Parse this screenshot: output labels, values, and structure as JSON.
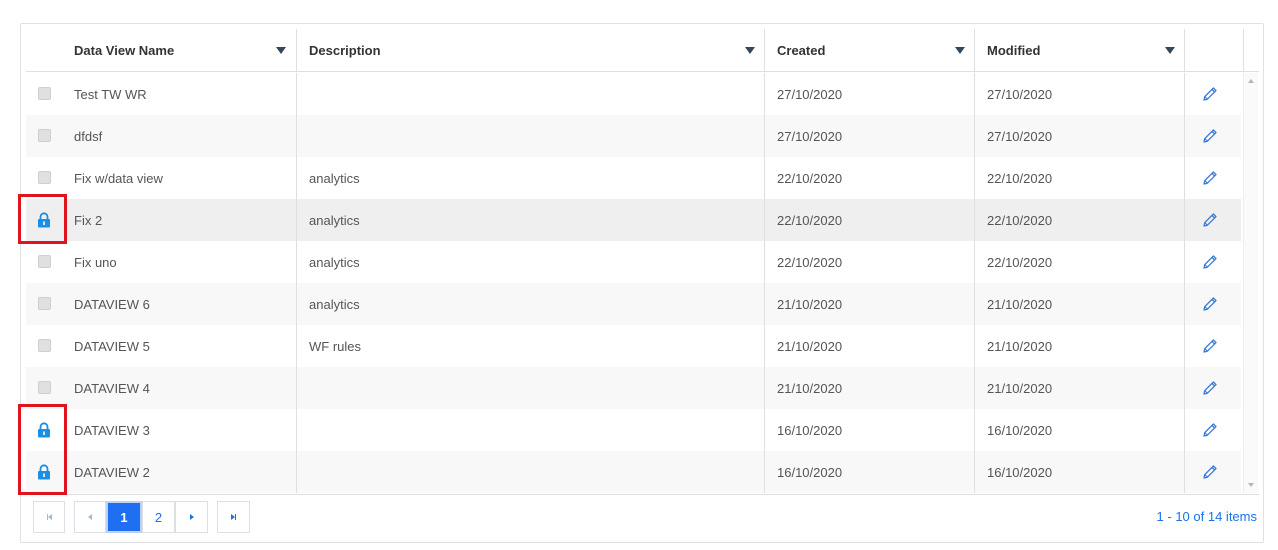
{
  "columns": {
    "name": "Data View Name",
    "description": "Description",
    "created": "Created",
    "modified": "Modified"
  },
  "rows": [
    {
      "name": "Test TW WR",
      "description": "",
      "created": "27/10/2020",
      "modified": "27/10/2020",
      "locked": false
    },
    {
      "name": "dfdsf",
      "description": "",
      "created": "27/10/2020",
      "modified": "27/10/2020",
      "locked": false
    },
    {
      "name": "Fix w/data view",
      "description": "analytics",
      "created": "22/10/2020",
      "modified": "22/10/2020",
      "locked": false
    },
    {
      "name": "Fix 2",
      "description": "analytics",
      "created": "22/10/2020",
      "modified": "22/10/2020",
      "locked": true
    },
    {
      "name": "Fix uno",
      "description": "analytics",
      "created": "22/10/2020",
      "modified": "22/10/2020",
      "locked": false
    },
    {
      "name": "DATAVIEW 6",
      "description": "analytics",
      "created": "21/10/2020",
      "modified": "21/10/2020",
      "locked": false
    },
    {
      "name": "DATAVIEW 5",
      "description": "WF rules",
      "created": "21/10/2020",
      "modified": "21/10/2020",
      "locked": false
    },
    {
      "name": "DATAVIEW 4",
      "description": "",
      "created": "21/10/2020",
      "modified": "21/10/2020",
      "locked": false
    },
    {
      "name": "DATAVIEW 3",
      "description": "",
      "created": "16/10/2020",
      "modified": "16/10/2020",
      "locked": true
    },
    {
      "name": "DATAVIEW 2",
      "description": "",
      "created": "16/10/2020",
      "modified": "16/10/2020",
      "locked": true
    }
  ],
  "pager": {
    "pages": [
      "1",
      "2"
    ],
    "current_page": "1",
    "info": "1 - 10 of 14 items"
  },
  "colors": {
    "accent": "#1e6ff2",
    "lock": "#1a8fe3",
    "highlight": "#e0141e"
  },
  "icons": {
    "row_edit": "pencil-icon",
    "row_lock": "lock-icon",
    "sort": "sort-arrow-icon"
  }
}
